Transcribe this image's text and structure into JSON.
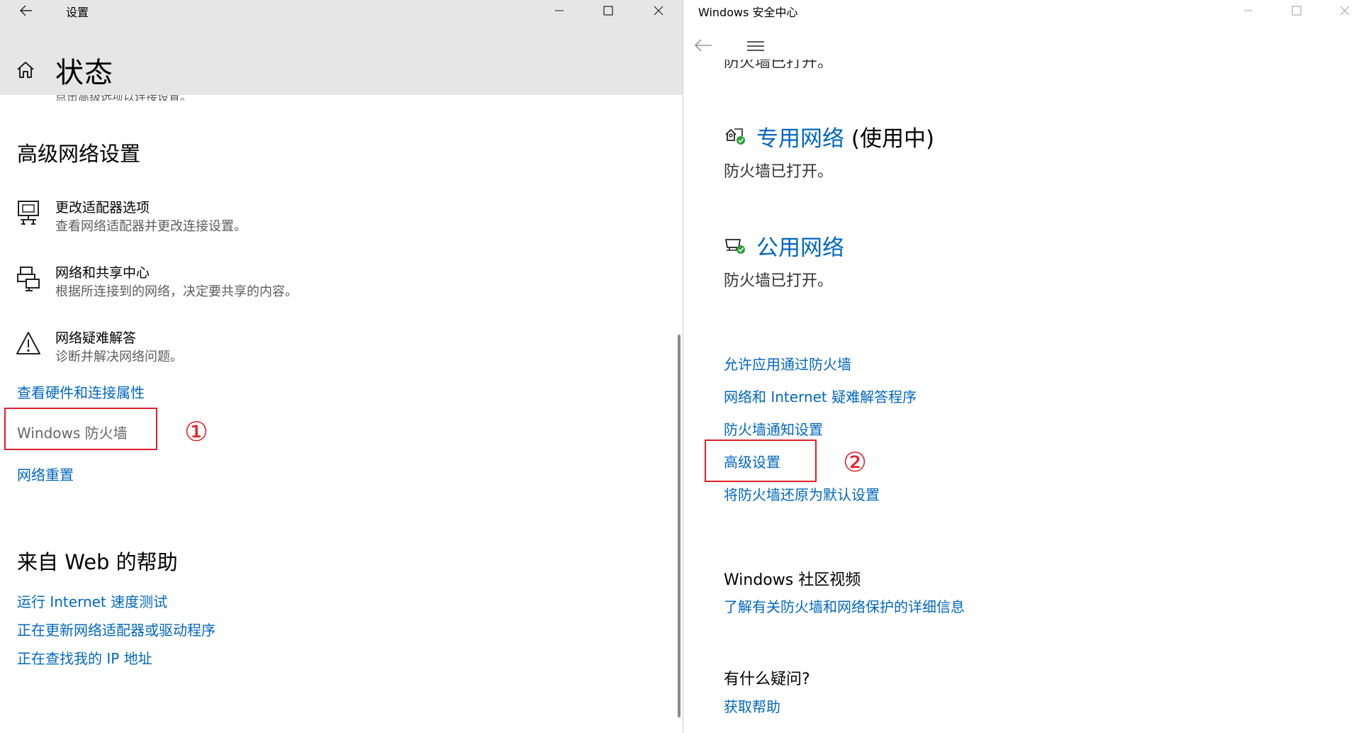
{
  "settings": {
    "window_title": "设置",
    "page_title": "状态",
    "clipped_text": "点击高级选项以连接设置。",
    "advanced_heading": "高级网络设置",
    "items": [
      {
        "title": "更改适配器选项",
        "desc": "查看网络适配器并更改连接设置。",
        "icon": "network-adapter-icon"
      },
      {
        "title": "网络和共享中心",
        "desc": "根据所连接到的网络，决定要共享的内容。",
        "icon": "sharing-center-icon"
      },
      {
        "title": "网络疑难解答",
        "desc": "诊断并解决网络问题。",
        "icon": "warning-triangle-icon"
      }
    ],
    "links": {
      "hardware": "查看硬件和连接属性",
      "firewall": "Windows 防火墙",
      "reset": "网络重置"
    },
    "web_help_heading": "来自 Web 的帮助",
    "web_links": [
      "运行 Internet 速度测试",
      "正在更新网络适配器或驱动程序",
      "正在查找我的 IP 地址"
    ],
    "annotation": "①"
  },
  "security": {
    "window_title": "Windows 安全中心",
    "clipped_text": "防火墙已打开。",
    "private_network": {
      "title": "专用网络",
      "suffix": " (使用中)",
      "status": "防火墙已打开。"
    },
    "public_network": {
      "title": "公用网络",
      "status": "防火墙已打开。"
    },
    "links": [
      "允许应用通过防火墙",
      "网络和 Internet 疑难解答程序",
      "防火墙通知设置",
      "高级设置",
      "将防火墙还原为默认设置"
    ],
    "community_heading": "Windows 社区视频",
    "community_link": "了解有关防火墙和网络保护的详细信息",
    "question_heading": "有什么疑问?",
    "help_link": "获取帮助",
    "annotation": "②"
  },
  "colors": {
    "link": "#0067c0",
    "annotation_red": "#e0202a",
    "titlebar": "#e6e6e6",
    "status_green": "#2e9e3a"
  }
}
